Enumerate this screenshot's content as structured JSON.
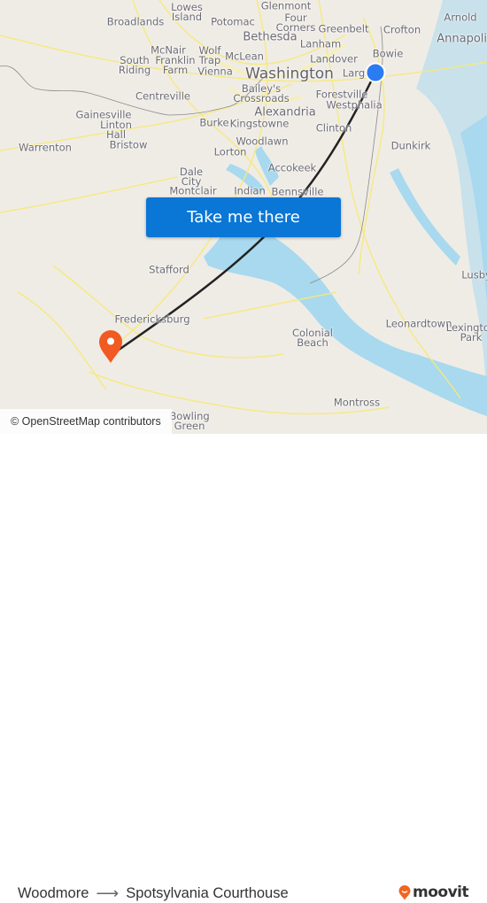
{
  "map": {
    "attribution": "© OpenStreetMap contributors",
    "origin_marker_color": "#2b7bf2",
    "destination_marker_color": "#f15a22",
    "route_color": "#222222",
    "places": [
      {
        "name": "Broadlands",
        "size": "normal"
      },
      {
        "name": "Lowes\nIsland",
        "size": "normal"
      },
      {
        "name": "Potomac",
        "size": "normal"
      },
      {
        "name": "Glenmont",
        "size": "normal"
      },
      {
        "name": "Four\nCorners",
        "size": "normal"
      },
      {
        "name": "Greenbelt",
        "size": "normal"
      },
      {
        "name": "Crofton",
        "size": "normal"
      },
      {
        "name": "Arnold",
        "size": "normal"
      },
      {
        "name": "Annapolis",
        "size": "mid"
      },
      {
        "name": "Bethesda",
        "size": "mid"
      },
      {
        "name": "Lanham",
        "size": "normal"
      },
      {
        "name": "Bowie",
        "size": "normal"
      },
      {
        "name": "McNair",
        "size": "normal"
      },
      {
        "name": "Franklin\nFarm",
        "size": "normal"
      },
      {
        "name": "Wolf\nTrap",
        "size": "normal"
      },
      {
        "name": "McLean",
        "size": "normal"
      },
      {
        "name": "South\nRiding",
        "size": "normal"
      },
      {
        "name": "Vienna",
        "size": "normal"
      },
      {
        "name": "Landover",
        "size": "normal"
      },
      {
        "name": "Washington",
        "size": "big"
      },
      {
        "name": "Largo",
        "size": "normal"
      },
      {
        "name": "Centreville",
        "size": "normal"
      },
      {
        "name": "Bailey's\nCrossroads",
        "size": "normal"
      },
      {
        "name": "Forestville",
        "size": "normal"
      },
      {
        "name": "Westphalia",
        "size": "normal"
      },
      {
        "name": "Alexandria",
        "size": "mid"
      },
      {
        "name": "Gainesville",
        "size": "normal"
      },
      {
        "name": "Linton\nHall",
        "size": "normal"
      },
      {
        "name": "Burke",
        "size": "normal"
      },
      {
        "name": "Kingstowne",
        "size": "normal"
      },
      {
        "name": "Clinton",
        "size": "normal"
      },
      {
        "name": "Woodlawn",
        "size": "normal"
      },
      {
        "name": "Bristow",
        "size": "normal"
      },
      {
        "name": "Warrenton",
        "size": "normal"
      },
      {
        "name": "Lorton",
        "size": "normal"
      },
      {
        "name": "Dunkirk",
        "size": "normal"
      },
      {
        "name": "Accokeek",
        "size": "normal"
      },
      {
        "name": "Dale\nCity",
        "size": "normal"
      },
      {
        "name": "Montclair",
        "size": "normal"
      },
      {
        "name": "Indian",
        "size": "normal"
      },
      {
        "name": "Bennsville",
        "size": "normal"
      },
      {
        "name": "Stafford",
        "size": "normal"
      },
      {
        "name": "Lusby",
        "size": "normal"
      },
      {
        "name": "Fredericksburg",
        "size": "normal"
      },
      {
        "name": "Leonardtown",
        "size": "normal"
      },
      {
        "name": "Lexington\nPark",
        "size": "normal"
      },
      {
        "name": "Colonial\nBeach",
        "size": "normal"
      },
      {
        "name": "Montross",
        "size": "normal"
      },
      {
        "name": "Bowling\nGreen",
        "size": "normal"
      }
    ]
  },
  "cta": {
    "label": "Take me there",
    "color": "#0a76d6"
  },
  "footer": {
    "origin": "Woodmore",
    "arrow": "⟶",
    "destination": "Spotsylvania Courthouse",
    "brand": "moovit",
    "brand_color": "#f26522"
  }
}
